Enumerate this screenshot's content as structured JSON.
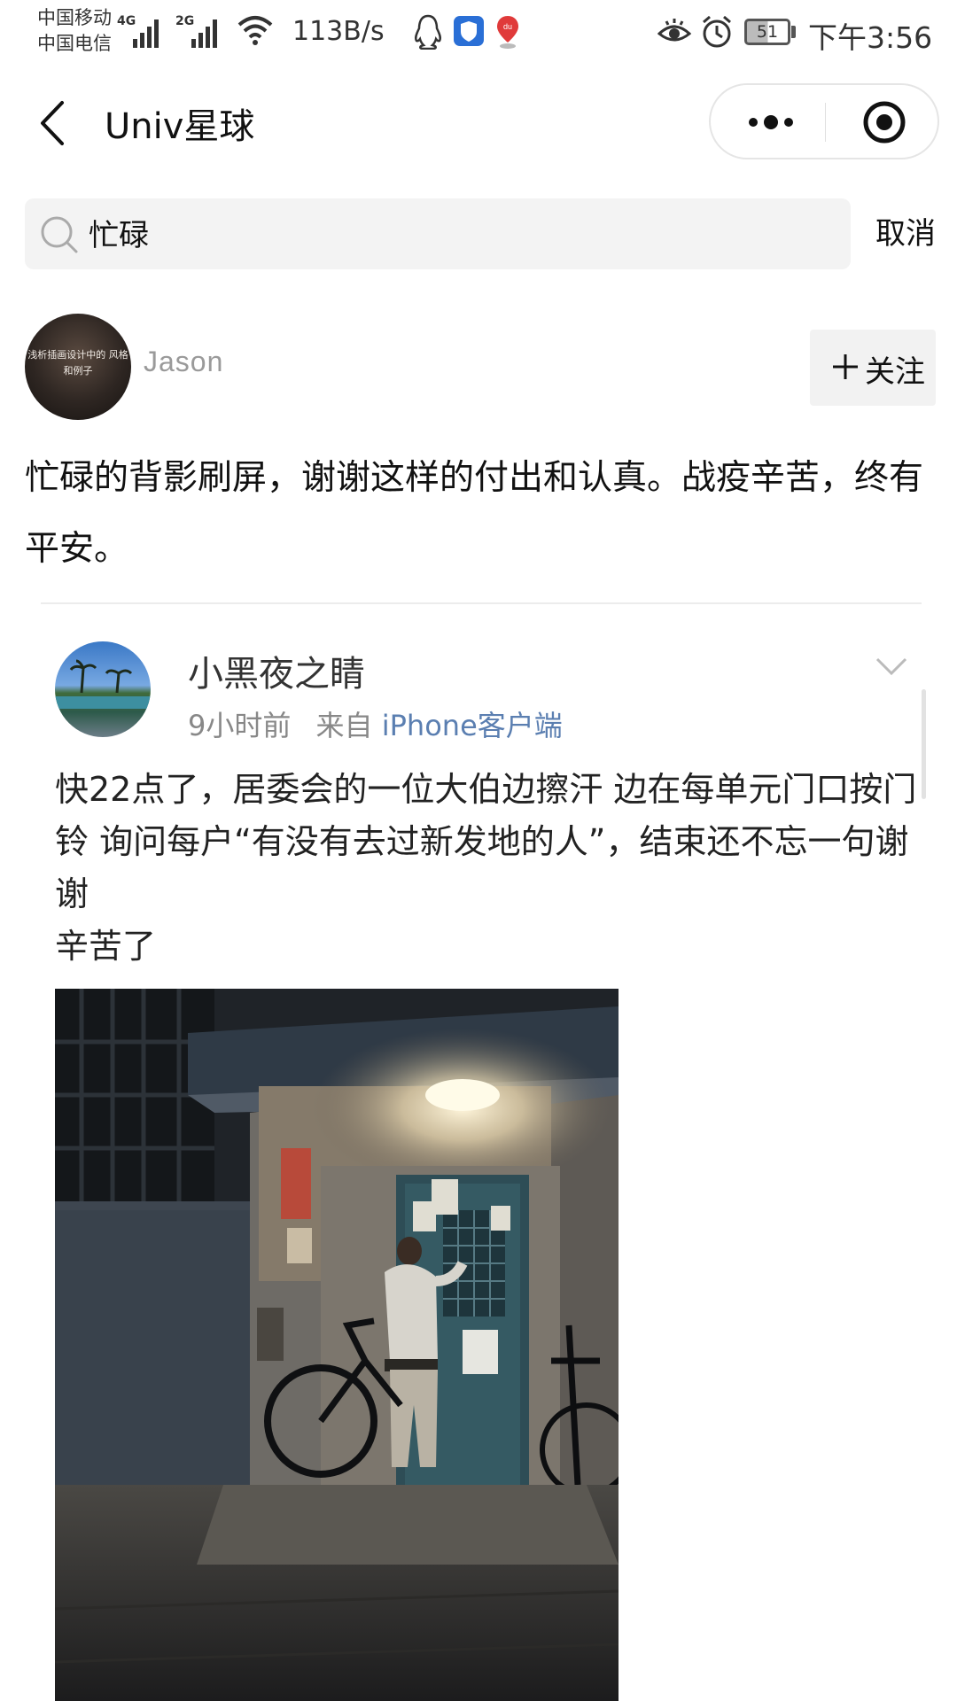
{
  "status_bar": {
    "carrier1": "中国移动",
    "carrier2": "中国电信",
    "net1": "4G",
    "net2": "2G",
    "speed": "113B/s",
    "battery": "51",
    "time": "下午3:56"
  },
  "nav": {
    "title": "Univ星球"
  },
  "search": {
    "query": "忙碌",
    "cancel_label": "取消"
  },
  "post": {
    "author": "Jason",
    "avatar_text": "浅析插画设计中的 风格和例子",
    "follow_label": "关注",
    "text": "忙碌的背影刷屏，谢谢这样的付出和认真。战疫辛苦，终有平安。"
  },
  "embedded": {
    "author": "小黑夜之睛",
    "time": "9小时前",
    "from": "来自",
    "source": "iPhone客户端",
    "text": "快22点了，居委会的一位大伯边擦汗 边在每单元门口按门铃 询问每户“有没有去过新发地的人”，结束还不忘一句谢谢\n辛苦了"
  },
  "colors": {
    "link": "#5b7fb1",
    "follow_bg": "#f2f2f2",
    "search_bg": "#f3f3f3"
  }
}
